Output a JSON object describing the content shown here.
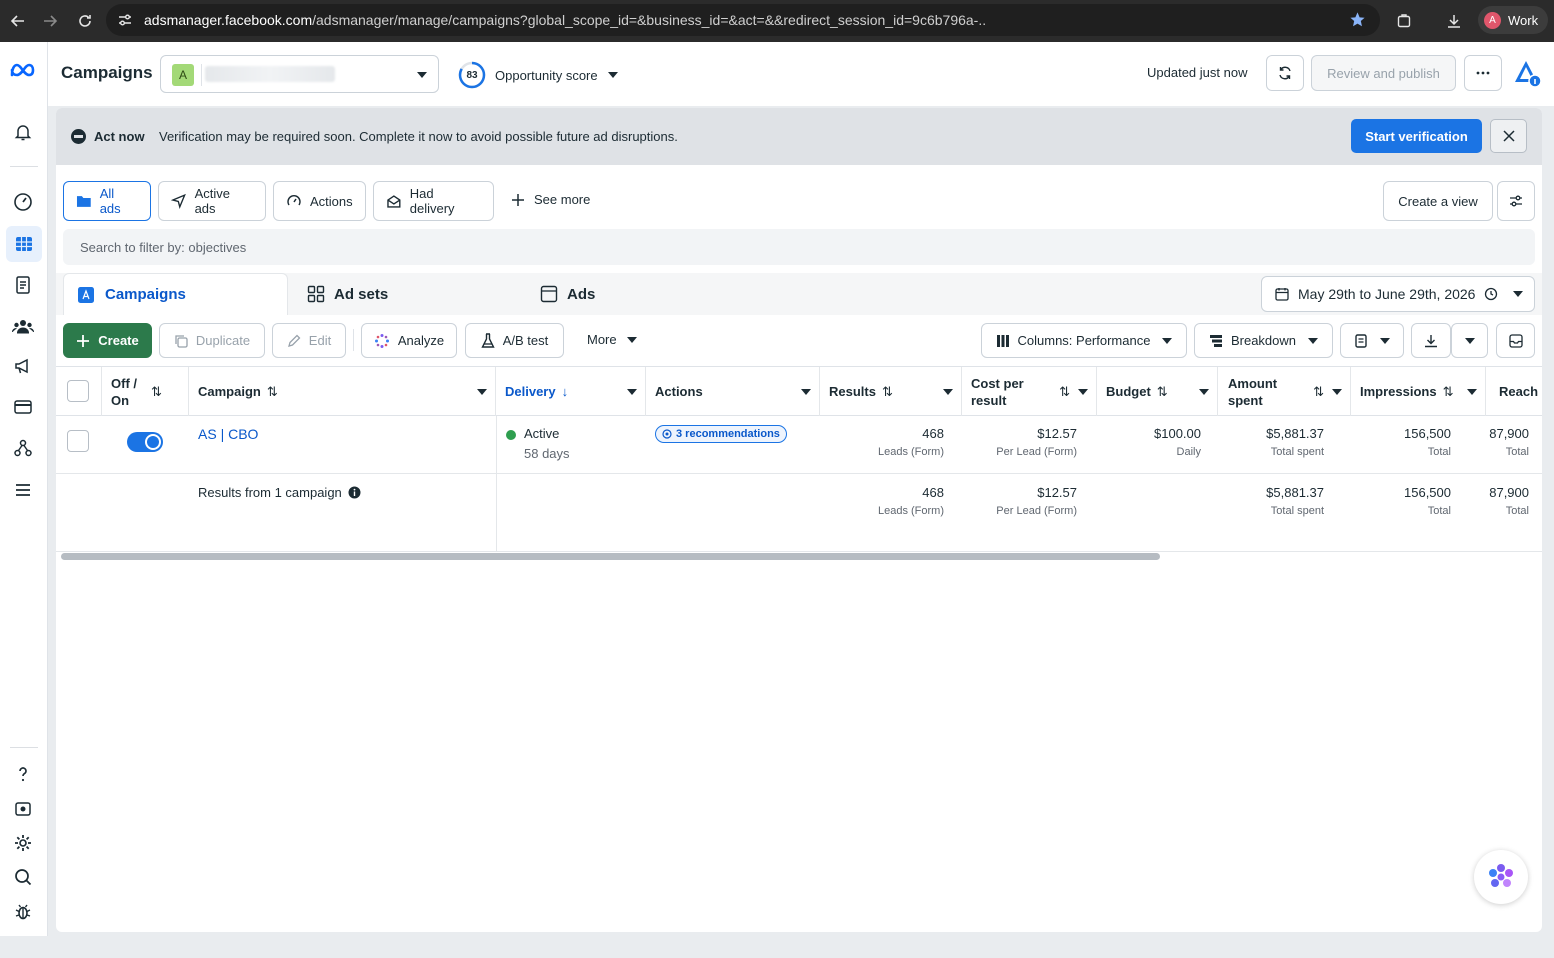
{
  "browser": {
    "url_domain": "adsmanager.facebook.com",
    "url_path": "/adsmanager/manage/campaigns?global_scope_id=&business_id=&act=&&redirect_session_id=9c6b796a-..",
    "profile_initial": "A",
    "profile_label": "Work",
    "colors": {
      "bar": "#2b2b2b",
      "avatar": "#e0566b"
    }
  },
  "header": {
    "title": "Campaigns",
    "account_initial": "A",
    "opportunity_score": "83",
    "opportunity_label": "Opportunity score",
    "updated_text": "Updated just now",
    "review_publish_label": "Review and publish"
  },
  "banner": {
    "title": "Act now",
    "message": "Verification may be required soon. Complete it now to avoid possible future ad disruptions.",
    "cta_label": "Start verification"
  },
  "filters": {
    "pills": [
      "All ads",
      "Active ads",
      "Actions",
      "Had delivery"
    ],
    "see_more_label": "See more",
    "create_view_label": "Create a view",
    "search_placeholder": "Search to filter by: objectives"
  },
  "tabs": {
    "campaigns": "Campaigns",
    "ad_sets": "Ad sets",
    "ads": "Ads"
  },
  "date_range": "May 29th to June 29th, 2026",
  "toolbar": {
    "create": "Create",
    "duplicate": "Duplicate",
    "edit": "Edit",
    "analyze": "Analyze",
    "ab_test": "A/B test",
    "more": "More",
    "columns": "Columns: Performance",
    "breakdown": "Breakdown"
  },
  "table": {
    "headers": {
      "off_on": "Off / On",
      "campaign": "Campaign",
      "delivery": "Delivery",
      "actions": "Actions",
      "results": "Results",
      "cost_per_result": "Cost per result",
      "budget": "Budget",
      "amount_spent": "Amount spent",
      "impressions": "Impressions",
      "reach": "Reach"
    },
    "row": {
      "toggle_on": true,
      "campaign_name": "AS | CBO",
      "delivery_status": "Active",
      "delivery_days": "58 days",
      "recommendations": "3 recommendations",
      "results": "468",
      "results_sub": "Leads (Form)",
      "cost_per_result": "$12.57",
      "cost_sub": "Per Lead (Form)",
      "budget": "$100.00",
      "budget_sub": "Daily",
      "amount_spent": "$5,881.37",
      "amount_sub": "Total spent",
      "impressions": "156,500",
      "impressions_sub": "Total",
      "reach": "87,900",
      "reach_sub": "Total"
    },
    "summary": {
      "label": "Results from 1 campaign",
      "results": "468",
      "results_sub": "Leads (Form)",
      "cost_per_result": "$12.57",
      "cost_sub": "Per Lead (Form)",
      "amount_spent": "$5,881.37",
      "amount_sub": "Total spent",
      "impressions": "156,500",
      "impressions_sub": "Total",
      "reach": "87,900",
      "reach_sub": "Total"
    }
  },
  "colors": {
    "accent": "#1b74e4",
    "create_green": "#2c7a4b",
    "active_dot": "#2e9e4f"
  }
}
